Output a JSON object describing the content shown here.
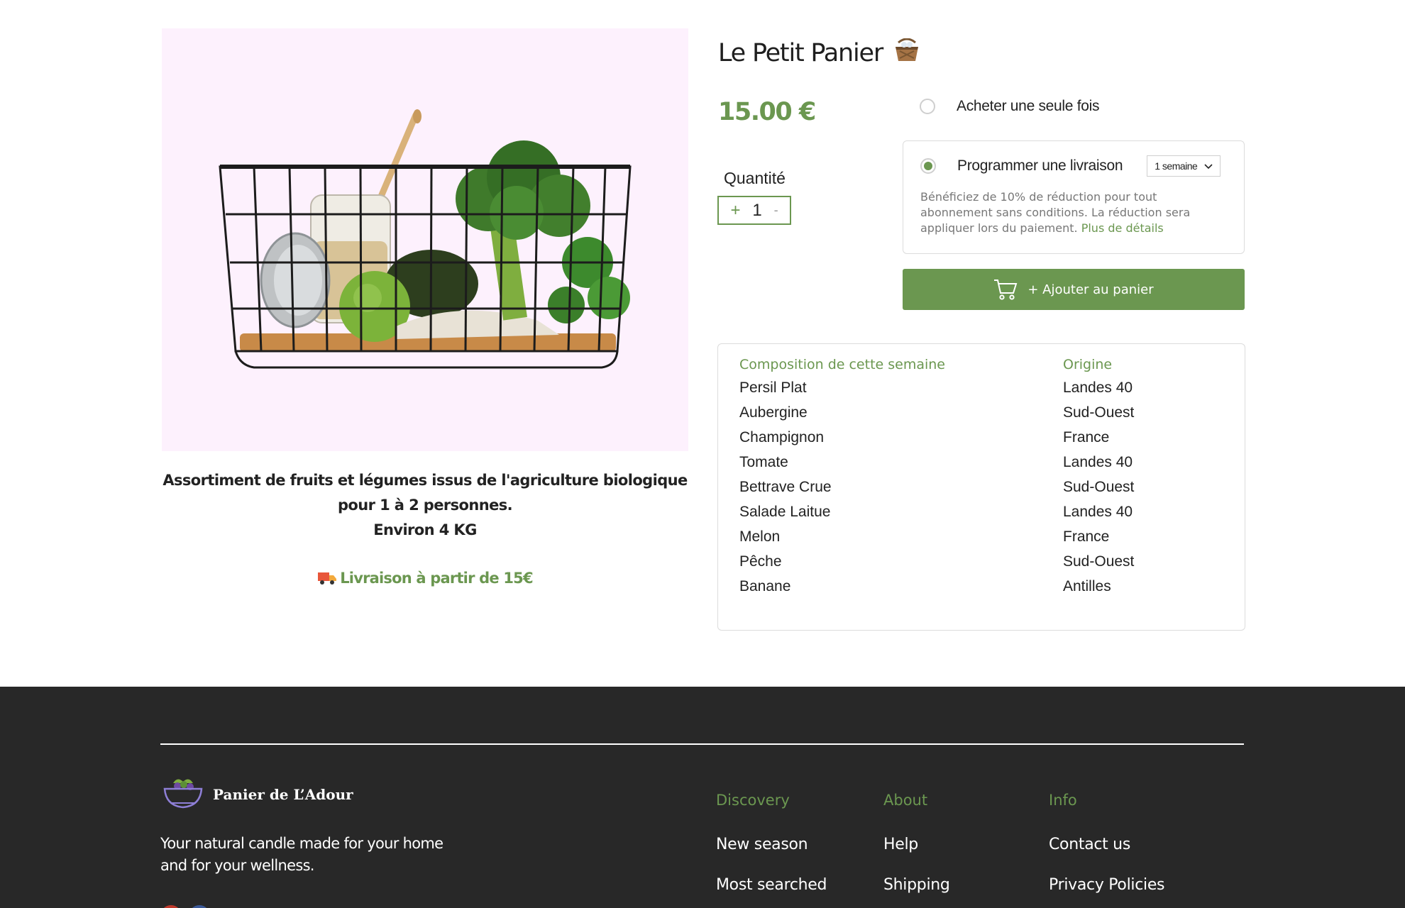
{
  "product": {
    "title": "Le Petit Panier",
    "price": "15.00 €",
    "description_line1": "Assortiment de fruits et légumes issus de l'agriculture biologique pour 1 à 2 personnes.",
    "weight": "Environ 4 KG",
    "delivery_note": "Livraison à partir de 15€",
    "image_alt": "Panier de fruits et légumes"
  },
  "quantity": {
    "label": "Quantité",
    "plus": "+",
    "value": "1",
    "minus": "-"
  },
  "purchase_options": {
    "once_label": "Acheter une seule fois",
    "schedule_label": "Programmer une livraison",
    "frequency": "1 semaine",
    "selected": "schedule",
    "subscription_text": "Bénéficiez de 10% de réduction pour tout abonnement sans conditions.  La réduction sera appliquer lors du paiement.",
    "details_link": "Plus de détails"
  },
  "cart_button": {
    "label": "+ Ajouter au panier"
  },
  "composition": {
    "header_product": "Composition de cette semaine",
    "header_origin": "Origine",
    "items": [
      {
        "name": "Persil Plat",
        "origin": "Landes 40"
      },
      {
        "name": "Aubergine",
        "origin": "Sud-Ouest"
      },
      {
        "name": "Champignon",
        "origin": "France"
      },
      {
        "name": "Tomate",
        "origin": "Landes 40"
      },
      {
        "name": "Bettrave Crue",
        "origin": "Sud-Ouest"
      },
      {
        "name": "Salade Laitue",
        "origin": "Landes 40"
      },
      {
        "name": "Melon",
        "origin": "France"
      },
      {
        "name": "Pêche",
        "origin": "Sud-Ouest"
      },
      {
        "name": "Banane",
        "origin": "Antilles"
      }
    ]
  },
  "footer": {
    "brand": "Panier de L’Adour",
    "tagline": "Your natural candle made for your home and for your wellness.",
    "columns": [
      {
        "title": "Discovery",
        "links": [
          "New season",
          "Most searched"
        ]
      },
      {
        "title": "About",
        "links": [
          "Help",
          "Shipping"
        ]
      },
      {
        "title": "Info",
        "links": [
          "Contact us",
          "Privacy Policies"
        ]
      }
    ]
  },
  "colors": {
    "accent": "#6b9750",
    "image_bg": "#fdf1fd",
    "footer_bg": "#282828"
  }
}
